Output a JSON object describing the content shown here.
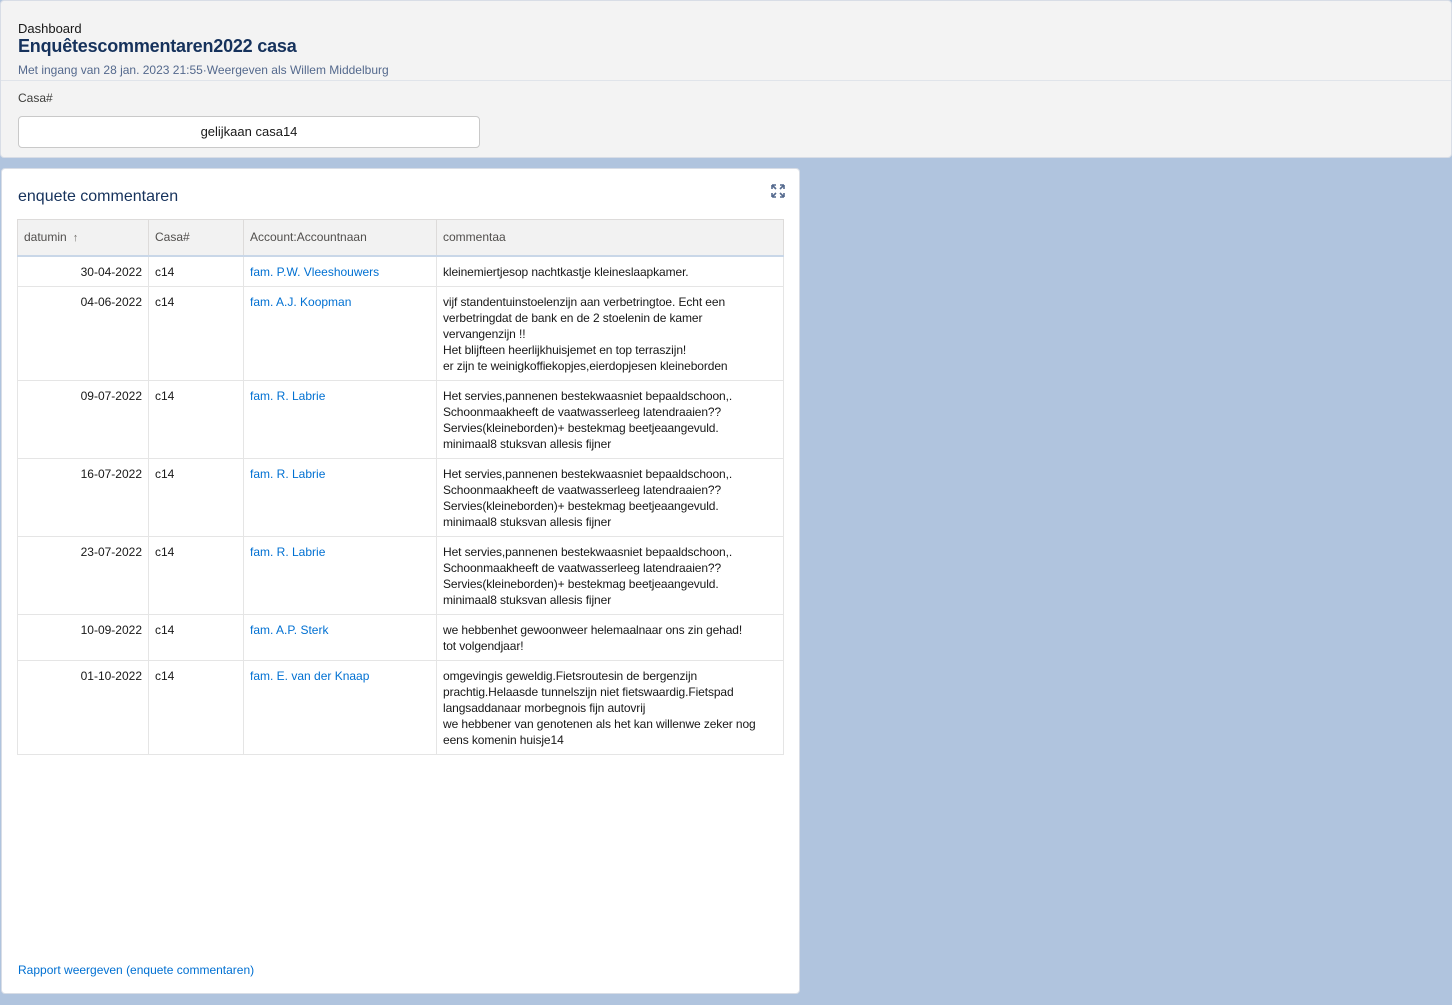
{
  "header": {
    "breadcrumb": "Dashboard",
    "title": "Enquêtescommentaren2022 casa",
    "subtitle": "Met ingang van 28 jan. 2023 21:55·Weergeven als Willem Middelburg",
    "filter_label": "Casa#",
    "filter_value": "gelijkaan casa14"
  },
  "card": {
    "title": "enquete commentaren",
    "expand_icon": "expand-icon",
    "report_link": "Rapport weergeven (enquete commentaren)",
    "columns": [
      "datumin",
      "Casa#",
      "Account:Accountnaan",
      "commentaa"
    ],
    "sort_icon": "↑",
    "rows": [
      {
        "date": "30-04-2022",
        "casa": "c14",
        "account": "fam. P.W. Vleeshouwers",
        "comment": "kleinemiertjesop nachtkastje kleineslaapkamer."
      },
      {
        "date": "04-06-2022",
        "casa": "c14",
        "account": "fam. A.J. Koopman",
        "comment": "vijf standentuinstoelenzijn aan verbetringtoe. Echt een verbetringdat de bank en de 2 stoelenin de kamer vervangenzijn !!\nHet blijfteen heerlijkhuisjemet en top terraszijn!\ner zijn te weinigkoffiekopjes,eierdopjesen kleineborden"
      },
      {
        "date": "09-07-2022",
        "casa": "c14",
        "account": "fam. R. Labrie",
        "comment": "Het servies,pannenen bestekwaasniet bepaaldschoon,.\nSchoonmaakheeft de vaatwasserleeg latendraaien??\nServies(kleineborden)+ bestekmag beetjeaangevuld.\nminimaal8 stuksvan allesis fijner"
      },
      {
        "date": "16-07-2022",
        "casa": "c14",
        "account": "fam. R. Labrie",
        "comment": "Het servies,pannenen bestekwaasniet bepaaldschoon,.\nSchoonmaakheeft de vaatwasserleeg latendraaien??\nServies(kleineborden)+ bestekmag beetjeaangevuld.\nminimaal8 stuksvan allesis fijner"
      },
      {
        "date": "23-07-2022",
        "casa": "c14",
        "account": "fam. R. Labrie",
        "comment": "Het servies,pannenen bestekwaasniet bepaaldschoon,.\nSchoonmaakheeft de vaatwasserleeg latendraaien??\nServies(kleineborden)+ bestekmag beetjeaangevuld.\nminimaal8 stuksvan allesis fijner"
      },
      {
        "date": "10-09-2022",
        "casa": "c14",
        "account": "fam. A.P. Sterk",
        "comment": "we hebbenhet gewoonweer helemaalnaar ons zin gehad!\ntot volgendjaar!"
      },
      {
        "date": "01-10-2022",
        "casa": "c14",
        "account": "fam. E. van der Knaap",
        "comment": "omgevingis geweldig.Fietsroutesin de bergenzijn prachtig.Helaasde tunnelszijn niet fietswaardig.Fietspad langsaddanaar morbegnois fijn autovrij\nwe hebbener van genotenen als het kan willenwe zeker nog eens komenin huisje14"
      }
    ]
  }
}
